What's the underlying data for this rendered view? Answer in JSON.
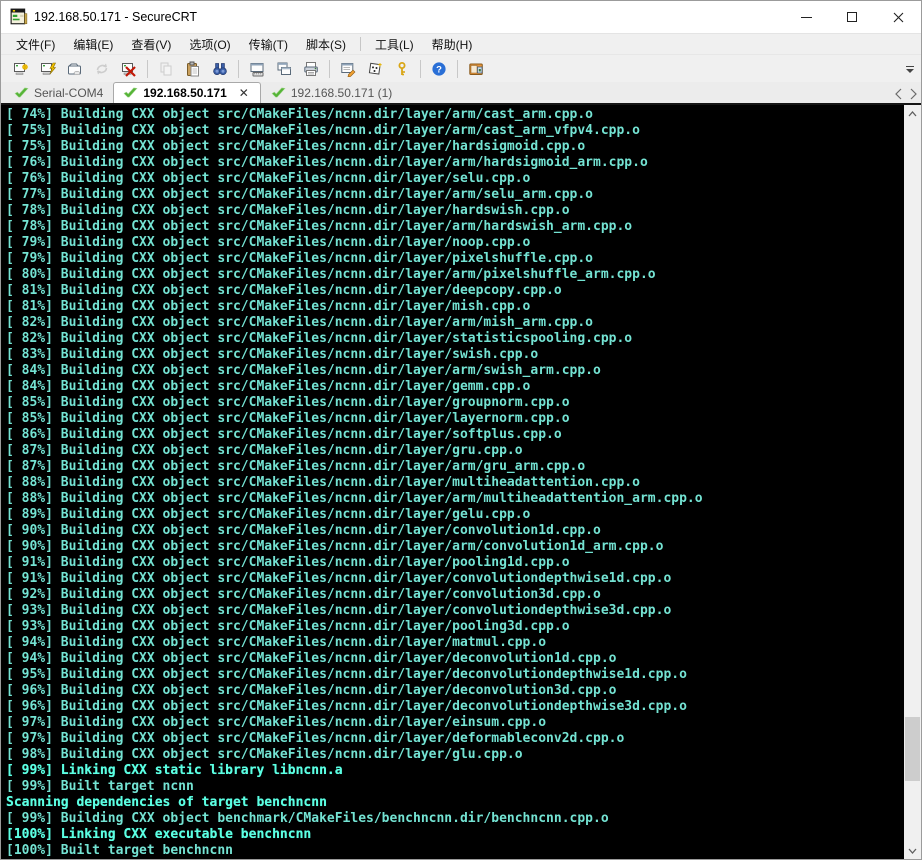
{
  "window": {
    "title": "192.168.50.171 - SecureCRT"
  },
  "menu": {
    "items": [
      {
        "label": "文件(F)"
      },
      {
        "label": "编辑(E)"
      },
      {
        "label": "查看(V)"
      },
      {
        "label": "选项(O)"
      },
      {
        "label": "传输(T)"
      },
      {
        "label": "脚本(S)"
      },
      {
        "label": "工具(L)",
        "divider_before": true
      },
      {
        "label": "帮助(H)"
      }
    ]
  },
  "toolbar": {
    "icons": [
      {
        "name": "quick-connect-icon",
        "disabled": false,
        "separator_after": false
      },
      {
        "name": "connect-icon",
        "disabled": false,
        "separator_after": false
      },
      {
        "name": "connect-tab-icon",
        "disabled": false,
        "separator_after": false
      },
      {
        "name": "reconnect-icon",
        "disabled": true,
        "separator_after": false
      },
      {
        "name": "disconnect-icon",
        "disabled": false,
        "separator_after": true
      },
      {
        "name": "copy-icon",
        "disabled": true,
        "separator_after": false
      },
      {
        "name": "paste-icon",
        "disabled": false,
        "separator_after": false
      },
      {
        "name": "find-icon",
        "disabled": false,
        "separator_after": true
      },
      {
        "name": "keymap-icon",
        "disabled": false,
        "separator_after": false
      },
      {
        "name": "cascade-windows-icon",
        "disabled": false,
        "separator_after": false
      },
      {
        "name": "print-icon",
        "disabled": false,
        "separator_after": true
      },
      {
        "name": "properties-icon",
        "disabled": false,
        "separator_after": false
      },
      {
        "name": "script-icon",
        "disabled": false,
        "separator_after": false
      },
      {
        "name": "key-icon",
        "disabled": false,
        "separator_after": true
      },
      {
        "name": "help-icon",
        "disabled": false,
        "separator_after": true
      },
      {
        "name": "session-manager-icon",
        "disabled": false,
        "separator_after": false
      }
    ]
  },
  "tabs": {
    "items": [
      {
        "label": "Serial-COM4",
        "active": false,
        "closable": false
      },
      {
        "label": "192.168.50.171",
        "active": true,
        "closable": true
      },
      {
        "label": "192.168.50.171 (1)",
        "active": false,
        "closable": false
      }
    ]
  },
  "terminal": {
    "lines": [
      {
        "text": "[ 74%] Building CXX object src/CMakeFiles/ncnn.dir/layer/arm/cast_arm.cpp.o",
        "bold": false
      },
      {
        "text": "[ 75%] Building CXX object src/CMakeFiles/ncnn.dir/layer/arm/cast_arm_vfpv4.cpp.o",
        "bold": false
      },
      {
        "text": "[ 75%] Building CXX object src/CMakeFiles/ncnn.dir/layer/hardsigmoid.cpp.o",
        "bold": false
      },
      {
        "text": "[ 76%] Building CXX object src/CMakeFiles/ncnn.dir/layer/arm/hardsigmoid_arm.cpp.o",
        "bold": false
      },
      {
        "text": "[ 76%] Building CXX object src/CMakeFiles/ncnn.dir/layer/selu.cpp.o",
        "bold": false
      },
      {
        "text": "[ 77%] Building CXX object src/CMakeFiles/ncnn.dir/layer/arm/selu_arm.cpp.o",
        "bold": false
      },
      {
        "text": "[ 78%] Building CXX object src/CMakeFiles/ncnn.dir/layer/hardswish.cpp.o",
        "bold": false
      },
      {
        "text": "[ 78%] Building CXX object src/CMakeFiles/ncnn.dir/layer/arm/hardswish_arm.cpp.o",
        "bold": false
      },
      {
        "text": "[ 79%] Building CXX object src/CMakeFiles/ncnn.dir/layer/noop.cpp.o",
        "bold": false
      },
      {
        "text": "[ 79%] Building CXX object src/CMakeFiles/ncnn.dir/layer/pixelshuffle.cpp.o",
        "bold": false
      },
      {
        "text": "[ 80%] Building CXX object src/CMakeFiles/ncnn.dir/layer/arm/pixelshuffle_arm.cpp.o",
        "bold": false
      },
      {
        "text": "[ 81%] Building CXX object src/CMakeFiles/ncnn.dir/layer/deepcopy.cpp.o",
        "bold": false
      },
      {
        "text": "[ 81%] Building CXX object src/CMakeFiles/ncnn.dir/layer/mish.cpp.o",
        "bold": false
      },
      {
        "text": "[ 82%] Building CXX object src/CMakeFiles/ncnn.dir/layer/arm/mish_arm.cpp.o",
        "bold": false
      },
      {
        "text": "[ 82%] Building CXX object src/CMakeFiles/ncnn.dir/layer/statisticspooling.cpp.o",
        "bold": false
      },
      {
        "text": "[ 83%] Building CXX object src/CMakeFiles/ncnn.dir/layer/swish.cpp.o",
        "bold": false
      },
      {
        "text": "[ 84%] Building CXX object src/CMakeFiles/ncnn.dir/layer/arm/swish_arm.cpp.o",
        "bold": false
      },
      {
        "text": "[ 84%] Building CXX object src/CMakeFiles/ncnn.dir/layer/gemm.cpp.o",
        "bold": false
      },
      {
        "text": "[ 85%] Building CXX object src/CMakeFiles/ncnn.dir/layer/groupnorm.cpp.o",
        "bold": false
      },
      {
        "text": "[ 85%] Building CXX object src/CMakeFiles/ncnn.dir/layer/layernorm.cpp.o",
        "bold": false
      },
      {
        "text": "[ 86%] Building CXX object src/CMakeFiles/ncnn.dir/layer/softplus.cpp.o",
        "bold": false
      },
      {
        "text": "[ 87%] Building CXX object src/CMakeFiles/ncnn.dir/layer/gru.cpp.o",
        "bold": false
      },
      {
        "text": "[ 87%] Building CXX object src/CMakeFiles/ncnn.dir/layer/arm/gru_arm.cpp.o",
        "bold": false
      },
      {
        "text": "[ 88%] Building CXX object src/CMakeFiles/ncnn.dir/layer/multiheadattention.cpp.o",
        "bold": false
      },
      {
        "text": "[ 88%] Building CXX object src/CMakeFiles/ncnn.dir/layer/arm/multiheadattention_arm.cpp.o",
        "bold": false
      },
      {
        "text": "[ 89%] Building CXX object src/CMakeFiles/ncnn.dir/layer/gelu.cpp.o",
        "bold": false
      },
      {
        "text": "[ 90%] Building CXX object src/CMakeFiles/ncnn.dir/layer/convolution1d.cpp.o",
        "bold": false
      },
      {
        "text": "[ 90%] Building CXX object src/CMakeFiles/ncnn.dir/layer/arm/convolution1d_arm.cpp.o",
        "bold": false
      },
      {
        "text": "[ 91%] Building CXX object src/CMakeFiles/ncnn.dir/layer/pooling1d.cpp.o",
        "bold": false
      },
      {
        "text": "[ 91%] Building CXX object src/CMakeFiles/ncnn.dir/layer/convolutiondepthwise1d.cpp.o",
        "bold": false
      },
      {
        "text": "[ 92%] Building CXX object src/CMakeFiles/ncnn.dir/layer/convolution3d.cpp.o",
        "bold": false
      },
      {
        "text": "[ 93%] Building CXX object src/CMakeFiles/ncnn.dir/layer/convolutiondepthwise3d.cpp.o",
        "bold": false
      },
      {
        "text": "[ 93%] Building CXX object src/CMakeFiles/ncnn.dir/layer/pooling3d.cpp.o",
        "bold": false
      },
      {
        "text": "[ 94%] Building CXX object src/CMakeFiles/ncnn.dir/layer/matmul.cpp.o",
        "bold": false
      },
      {
        "text": "[ 94%] Building CXX object src/CMakeFiles/ncnn.dir/layer/deconvolution1d.cpp.o",
        "bold": false
      },
      {
        "text": "[ 95%] Building CXX object src/CMakeFiles/ncnn.dir/layer/deconvolutiondepthwise1d.cpp.o",
        "bold": false
      },
      {
        "text": "[ 96%] Building CXX object src/CMakeFiles/ncnn.dir/layer/deconvolution3d.cpp.o",
        "bold": false
      },
      {
        "text": "[ 96%] Building CXX object src/CMakeFiles/ncnn.dir/layer/deconvolutiondepthwise3d.cpp.o",
        "bold": false
      },
      {
        "text": "[ 97%] Building CXX object src/CMakeFiles/ncnn.dir/layer/einsum.cpp.o",
        "bold": false
      },
      {
        "text": "[ 97%] Building CXX object src/CMakeFiles/ncnn.dir/layer/deformableconv2d.cpp.o",
        "bold": false
      },
      {
        "text": "[ 98%] Building CXX object src/CMakeFiles/ncnn.dir/layer/glu.cpp.o",
        "bold": false
      },
      {
        "text": "[ 99%] Linking CXX static library libncnn.a",
        "bold": true
      },
      {
        "text": "[ 99%] Built target ncnn",
        "bold": false
      },
      {
        "text": "Scanning dependencies of target benchncnn",
        "bold": true
      },
      {
        "text": "[ 99%] Building CXX object benchmark/CMakeFiles/benchncnn.dir/benchncnn.cpp.o",
        "bold": false
      },
      {
        "text": "[100%] Linking CXX executable benchncnn",
        "bold": true
      },
      {
        "text": "[100%] Built target benchncnn",
        "bold": false
      }
    ]
  },
  "colors": {
    "terminal_bg": "#000000",
    "text_normal": "#74e3d3",
    "text_bright": "#5bffe3",
    "tab_check_green": "#55b437",
    "help_blue": "#2a6fd6",
    "disconnect_red": "#c21807",
    "key_gold": "#d9a616"
  }
}
